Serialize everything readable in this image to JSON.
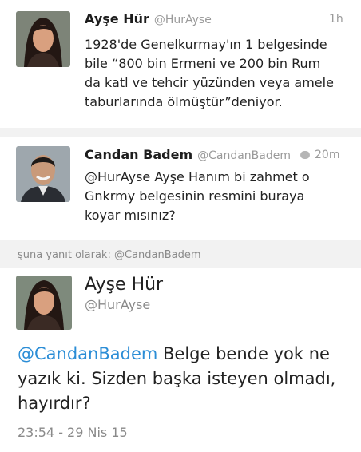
{
  "tweet1": {
    "name": "Ayşe Hür",
    "handle": "@HurAyse",
    "time": "1h",
    "lines": [
      "1928'de Genelkurmay'ın 1 belgesinde",
      "bile “800 bin Ermeni ve 200 bin Rum",
      "da katl ve tehcir yüzünden veya amele",
      "taburlarında ölmüştür”deniyor."
    ]
  },
  "tweet2": {
    "name": "Candan Badem",
    "handle": "@CandanBadem",
    "time": "20m",
    "lines": [
      "@HurAyse Ayşe Hanım bi zahmet o",
      "Gnkrmy belgesinin resmini buraya",
      "koyar mısınız?"
    ]
  },
  "reply_context": "şuna yanıt olarak: @CandanBadem",
  "tweet3": {
    "name": "Ayşe Hür",
    "handle": "@HurAyse",
    "mention": "@CandanBadem",
    "line1_rest": " Belge bende yok ne",
    "line2": "yazık ki. Sizden başka isteyen olmadı,",
    "line3": "hayırdır?",
    "timestamp": "23:54 - 29 Nis 15"
  },
  "icons": {
    "avatar1": "woman-portrait",
    "avatar2": "man-portrait",
    "avatar3": "woman-portrait",
    "reply_count": "speech-bubble-icon"
  }
}
